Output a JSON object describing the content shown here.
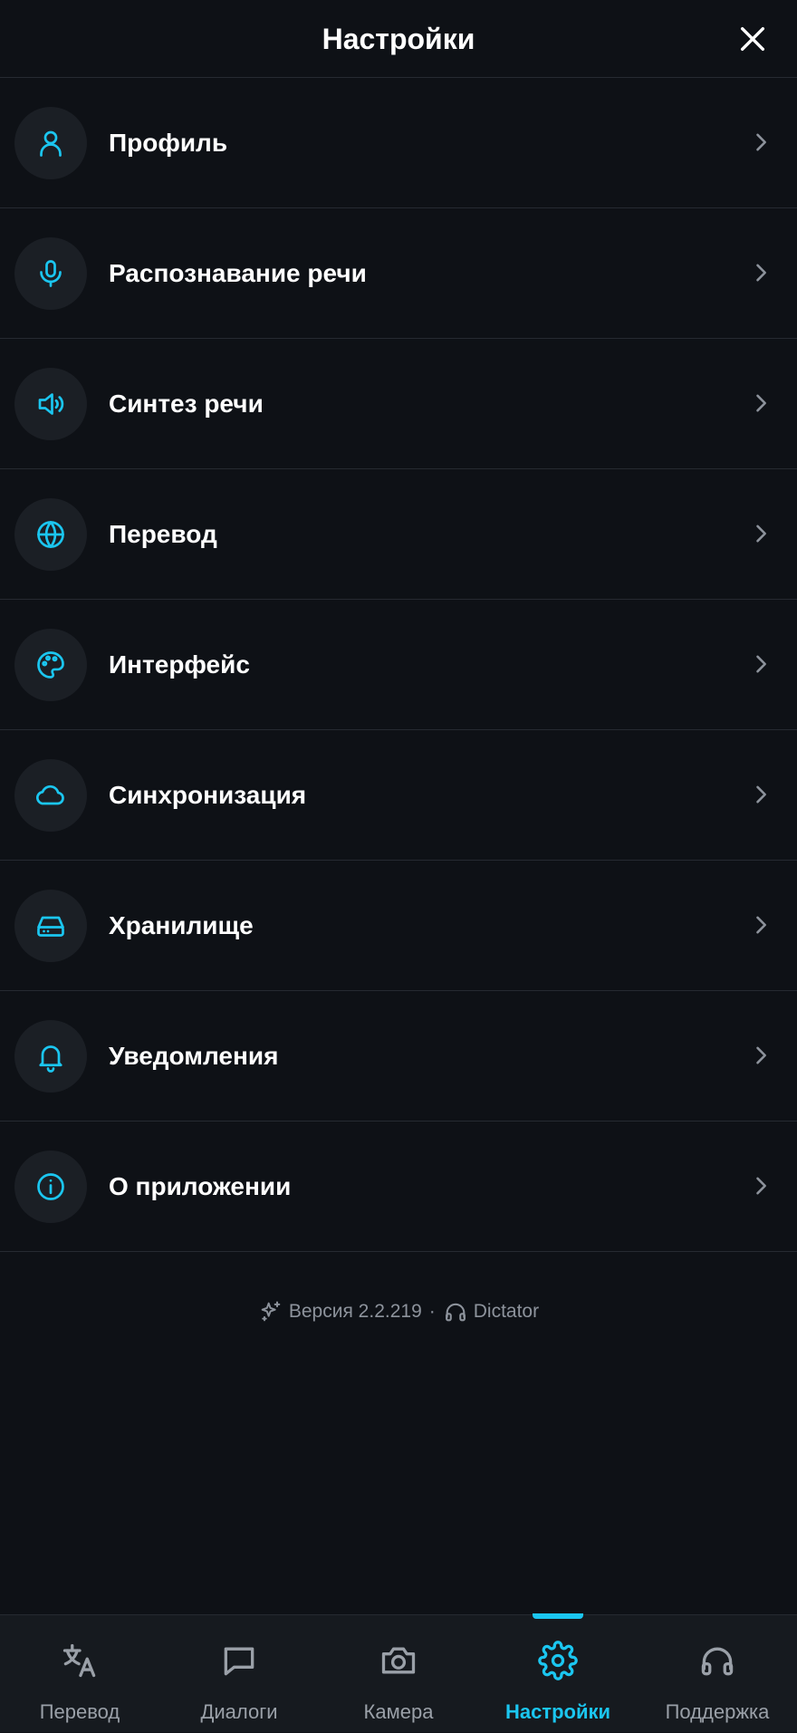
{
  "header": {
    "title": "Настройки",
    "close_icon": "close-icon"
  },
  "colors": {
    "background": "#0e1116",
    "accent": "#1bc6f0",
    "icon_circle": "#1b1f25",
    "muted_text": "#8d939c"
  },
  "menu": [
    {
      "label": "Профиль",
      "icon": "user-icon"
    },
    {
      "label": "Распознавание речи",
      "icon": "microphone-icon"
    },
    {
      "label": "Синтез речи",
      "icon": "speaker-icon"
    },
    {
      "label": "Перевод",
      "icon": "globe-icon"
    },
    {
      "label": "Интерфейс",
      "icon": "palette-icon"
    },
    {
      "label": "Синхронизация",
      "icon": "cloud-icon"
    },
    {
      "label": "Хранилище",
      "icon": "hard-drive-icon"
    },
    {
      "label": "Уведомления",
      "icon": "bell-icon"
    },
    {
      "label": "О приложении",
      "icon": "info-icon"
    }
  ],
  "footer": {
    "version": "Версия 2.2.219",
    "separator": "·",
    "app_name": "Dictator"
  },
  "nav": {
    "active_index": 3,
    "items": [
      {
        "label": "Перевод",
        "icon": "translate-icon"
      },
      {
        "label": "Диалоги",
        "icon": "chat-icon"
      },
      {
        "label": "Камера",
        "icon": "camera-icon"
      },
      {
        "label": "Настройки",
        "icon": "settings-gear-icon"
      },
      {
        "label": "Поддержка",
        "icon": "headphones-icon"
      }
    ]
  }
}
